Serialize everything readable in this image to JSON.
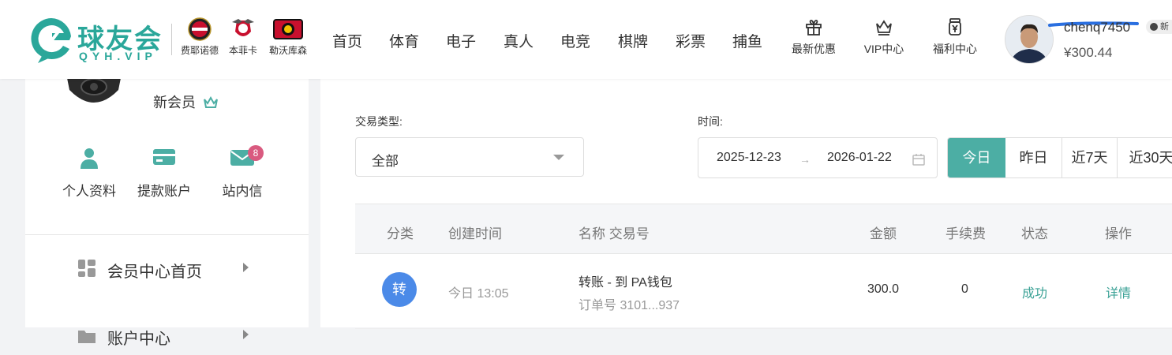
{
  "brand": {
    "name": "球友会",
    "sub": "QYH.VIP"
  },
  "clubs": [
    {
      "name": "费耶诺德",
      "icon": "feyenoord-crest-icon"
    },
    {
      "name": "本菲卡",
      "icon": "benfica-crest-icon"
    },
    {
      "name": "勒沃库森",
      "icon": "leverkusen-crest-icon"
    }
  ],
  "nav": [
    "首页",
    "体育",
    "电子",
    "真人",
    "电竞",
    "棋牌",
    "彩票",
    "捕鱼"
  ],
  "header_links": [
    {
      "label": "最新优惠",
      "icon": "gift-icon"
    },
    {
      "label": "VIP中心",
      "icon": "crown-icon"
    },
    {
      "label": "福利中心",
      "icon": "yen-jar-icon"
    }
  ],
  "user": {
    "name": "chenq7450",
    "balance": "¥300.44",
    "badge": "新"
  },
  "sidebar": {
    "level": "新会员",
    "quick": [
      {
        "label": "个人资料",
        "icon": "user-icon"
      },
      {
        "label": "提款账户",
        "icon": "card-icon"
      },
      {
        "label": "站内信",
        "icon": "mail-icon",
        "badge": "8"
      }
    ],
    "menu": [
      {
        "label": "会员中心首页",
        "icon": "dashboard-icon"
      },
      {
        "label": "账户中心",
        "icon": "folder-icon"
      }
    ]
  },
  "filters": {
    "type_label": "交易类型:",
    "type_value": "全部",
    "time_label": "时间:",
    "date_start": "2025-12-23",
    "date_end": "2026-01-22",
    "quick_ranges": [
      "今日",
      "昨日",
      "近7天",
      "近30天"
    ],
    "active_range": "今日"
  },
  "table": {
    "headers": [
      "分类",
      "创建时间",
      "名称 交易号",
      "金额",
      "手续费",
      "状态",
      "操作"
    ],
    "rows": [
      {
        "category": "转",
        "time": "今日 13:05",
        "name": "转账 - 到 PA钱包",
        "order": "订单号 3101...937",
        "amount": "300.0",
        "fee": "0",
        "status": "成功",
        "action": "详情"
      }
    ]
  },
  "colors": {
    "accent": "#4caea4",
    "brand": "#2aa79a",
    "category_blue": "#4b8ae8",
    "badge": "#d95a7f"
  }
}
